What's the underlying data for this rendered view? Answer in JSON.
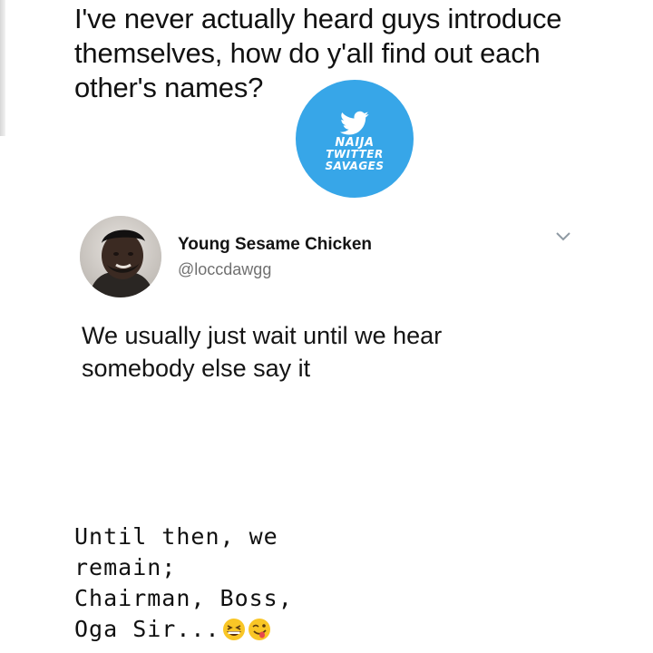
{
  "question": {
    "lines": [
      "I've never actually heard guys introduce",
      "themselves, how do y'all find out each",
      "other's names?"
    ]
  },
  "logo": {
    "lines": [
      "NAIJA",
      "TWITTER",
      "SAVAGES"
    ],
    "icon": "bird-icon",
    "color": "#37a6e8"
  },
  "tweet": {
    "display_name": "Young Sesame Chicken",
    "handle": "@loccdawgg",
    "body_lines": [
      "We usually just wait until we hear",
      "somebody else say it"
    ]
  },
  "caption": {
    "lines": [
      "Until then, we",
      "remain;",
      "Chairman, Boss,",
      "Oga Sir..."
    ],
    "emojis": [
      "grinning-squinting-face-icon",
      "winking-tongue-face-icon"
    ]
  }
}
